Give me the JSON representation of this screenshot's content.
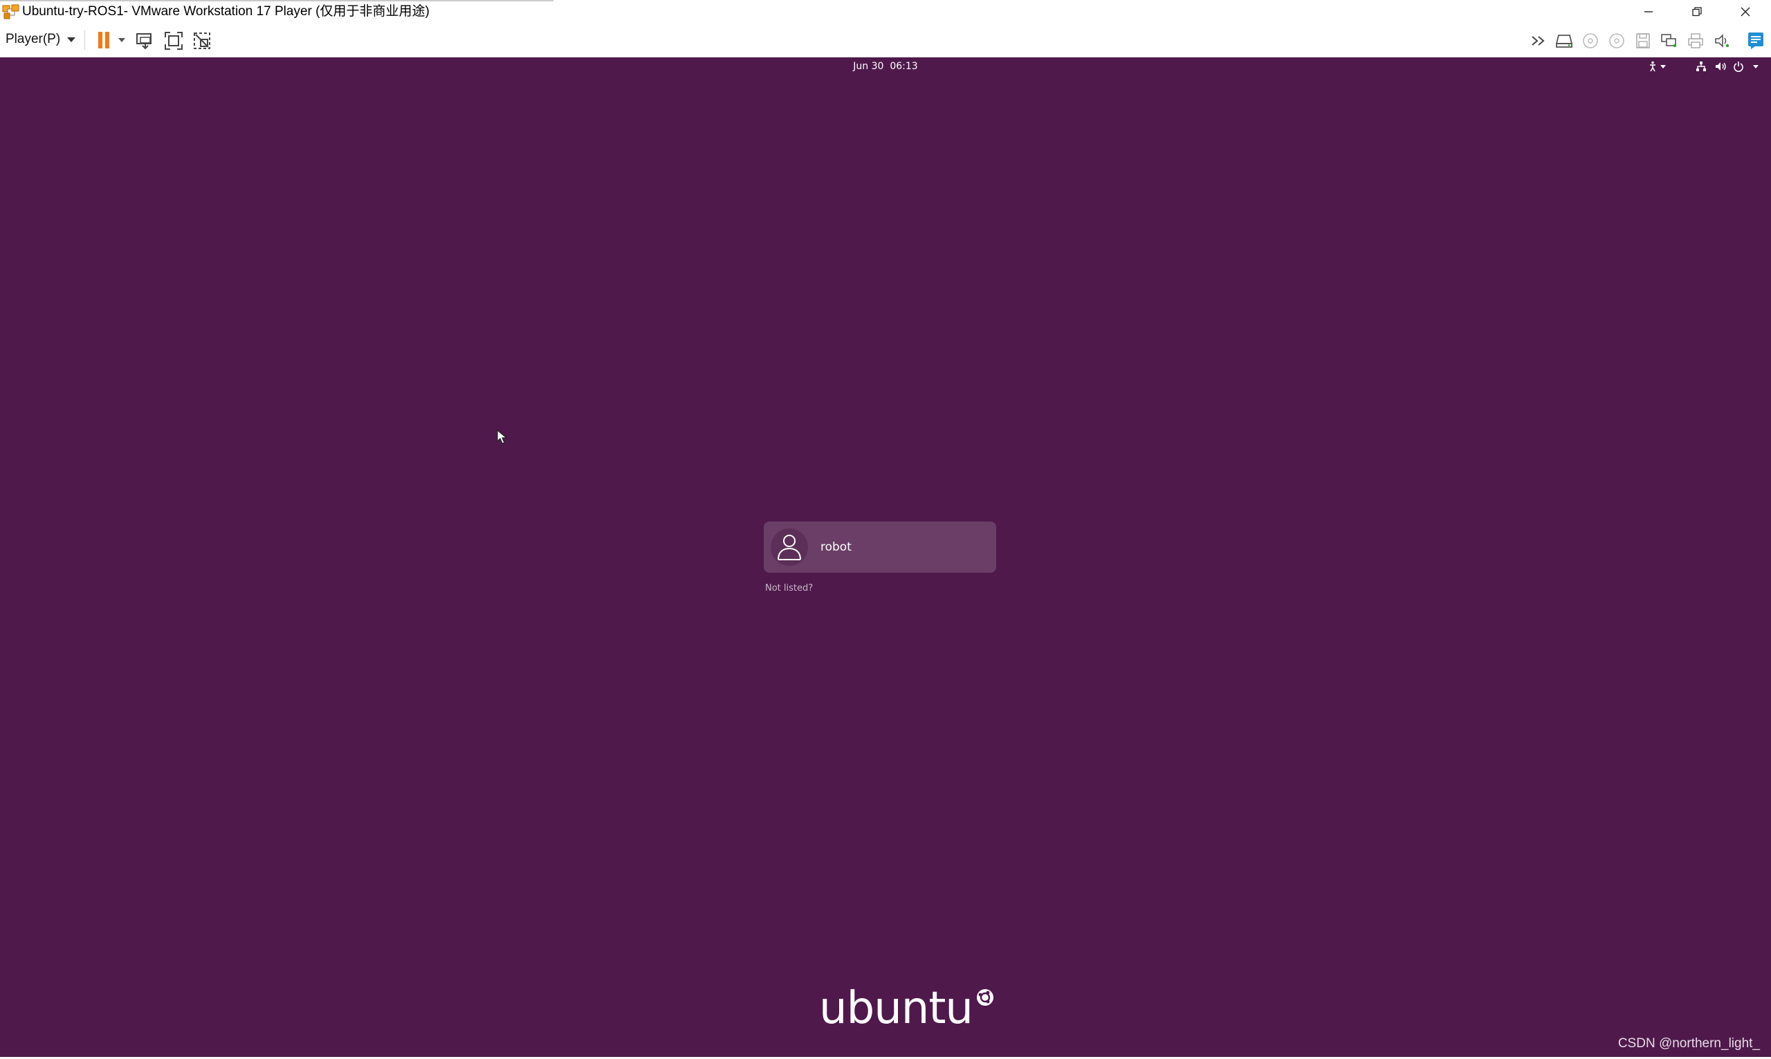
{
  "window": {
    "title": "Ubuntu-try-ROS1- VMware Workstation 17 Player (仅用于非商业用途)",
    "app_icon": "vmware-player-icon",
    "controls": [
      "minimize-icon",
      "restore-icon",
      "close-icon"
    ]
  },
  "toolbar": {
    "player_menu_label": "Player(P)",
    "left_icons": [
      "pause-icon",
      "send-ctrl-alt-del-icon",
      "full-screen-icon",
      "unity-icon"
    ],
    "right_icons": [
      "more-devices-icon",
      "hard-disk-icon",
      "cd-dvd-icon",
      "cd-dvd-2-icon",
      "floppy-icon",
      "network-adapter-icon",
      "printer-icon",
      "sound-card-icon",
      "message-log-icon"
    ]
  },
  "vm": {
    "clock": "Jun 30  06:13",
    "topbar_icons": [
      "accessibility-icon",
      "network-icon",
      "volume-icon",
      "power-icon"
    ],
    "login": {
      "username": "robot",
      "not_listed": "Not listed?"
    },
    "logo_text": "ubuntu",
    "background_color": "#4f194c"
  },
  "watermark": "CSDN @northern_light_"
}
